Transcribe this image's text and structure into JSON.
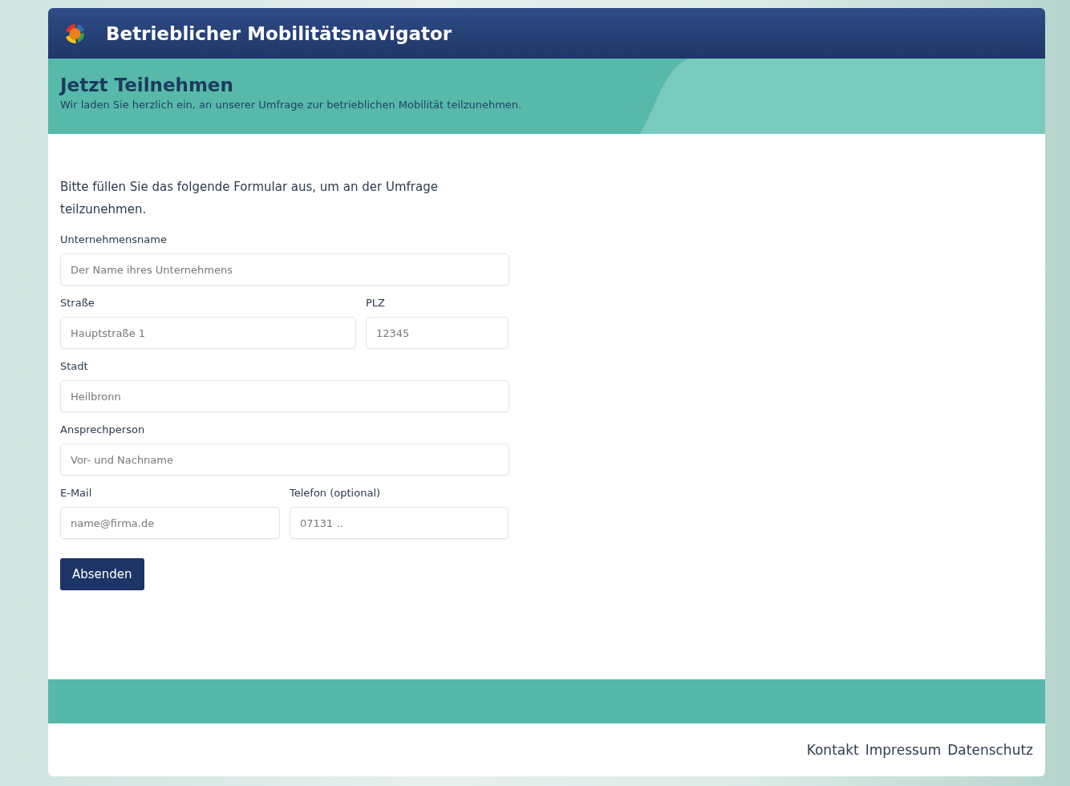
{
  "header": {
    "title": "Betrieblicher Mobilitätsnavigator"
  },
  "hero": {
    "title": "Jetzt Teilnehmen",
    "subtitle": "Wir laden Sie herzlich ein, an unserer Umfrage zur betrieblichen Mobilität teilzunehmen."
  },
  "form": {
    "intro": "Bitte füllen Sie das folgende Formular aus, um an der Umfrage teilzunehmen.",
    "rows": [
      [
        {
          "label": "Unternehmensname",
          "placeholder": "Der Name ihres Unternehmens"
        }
      ],
      [
        {
          "label": "Straße",
          "placeholder": "Hauptstraße 1"
        },
        {
          "label": "PLZ",
          "placeholder": "12345"
        }
      ],
      [
        {
          "label": "Stadt",
          "placeholder": "Heilbronn"
        }
      ],
      [
        {
          "label": "Ansprechperson",
          "placeholder": "Vor- und Nachname"
        }
      ],
      [
        {
          "label": "E-Mail",
          "placeholder": "name@firma.de"
        },
        {
          "label": "Telefon (optional)",
          "placeholder": "07131 .."
        }
      ]
    ],
    "submit": "Absenden"
  },
  "footer": {
    "links": [
      "Kontakt",
      "Impressum",
      "Datenschutz"
    ]
  }
}
